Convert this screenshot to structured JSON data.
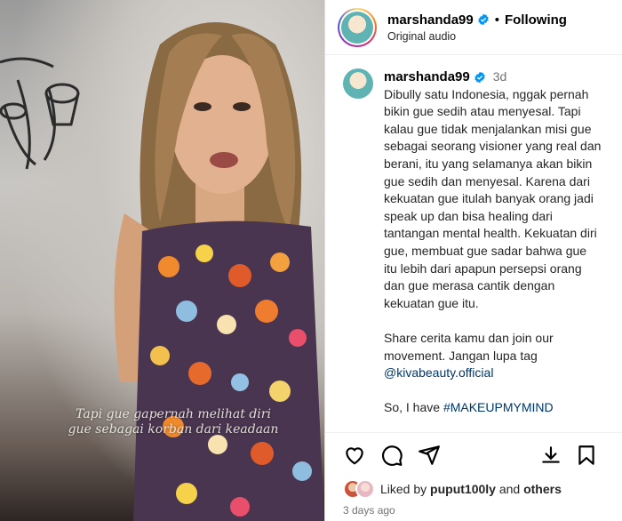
{
  "header": {
    "username": "marshanda99",
    "separator": "•",
    "follow_status": "Following",
    "audio": "Original audio"
  },
  "video": {
    "caption_line1": "Tapi gue gapernah melihat diri",
    "caption_line2": "gue sebagai korban dari keadaan"
  },
  "comment": {
    "username": "marshanda99",
    "time": "3d",
    "lines": [
      "Dibully satu Indonesia, nggak pernah",
      "bikin gue sedih atau menyesal. Tapi",
      "kalau gue tidak menjalankan misi gue",
      "sebagai seorang visioner yang real dan",
      "berani, itu yang selamanya akan bikin",
      "gue sedih dan menyesal. Karena dari",
      "kekuatan gue itulah banyak orang jadi",
      "speak up dan bisa healing dari",
      "tantangan mental health. Kekuatan diri",
      "gue, membuat gue sadar bahwa gue",
      "itu lebih dari apapun persepsi orang",
      "dan gue merasa cantik dengan",
      "kekuatan gue itu."
    ],
    "p2_lines": [
      "Share cerita kamu dan join our",
      "movement. Jangan lupa tag"
    ],
    "mention": "@kivabeauty.official",
    "p3_prefix": "So, I have ",
    "hashtag": "#MAKEUPMYMIND"
  },
  "actions": {
    "icons": [
      "heart-icon",
      "comment-icon",
      "share-icon",
      "save-icon"
    ]
  },
  "likes": {
    "prefix": "Liked by ",
    "user": "puput100ly",
    "middle": " and ",
    "others": "others"
  },
  "timestamp": "3 days ago",
  "colors": {
    "verified": "#0095f6",
    "link": "#00376b",
    "secondary_text": "#737373"
  }
}
